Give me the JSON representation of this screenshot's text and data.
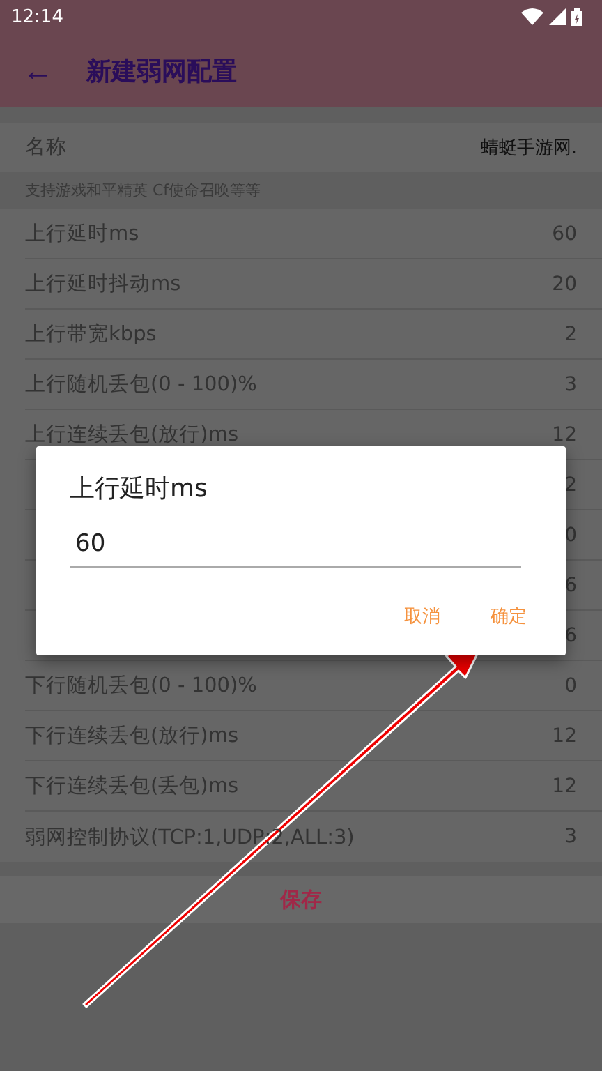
{
  "status_bar": {
    "time": "12:14"
  },
  "app_bar": {
    "back_icon": "←",
    "title": "新建弱网配置"
  },
  "name_row": {
    "label": "名称",
    "value": "蜻蜓手游网."
  },
  "hint": "支持游戏和平精英 Cf使命召唤等等",
  "rows": [
    {
      "label": "上行延时ms",
      "value": "60"
    },
    {
      "label": "上行延时抖动ms",
      "value": "20"
    },
    {
      "label": "上行带宽kbps",
      "value": "2"
    },
    {
      "label": "上行随机丢包(0 - 100)%",
      "value": "3"
    },
    {
      "label": "上行连续丢包(放行)ms",
      "value": "12"
    },
    {
      "value": "2"
    },
    {
      "value": "0"
    },
    {
      "value": "6"
    },
    {
      "value": "6"
    },
    {
      "label": "下行随机丢包(0 - 100)%",
      "value": "0"
    },
    {
      "label": "下行连续丢包(放行)ms",
      "value": "12"
    },
    {
      "label": "下行连续丢包(丢包)ms",
      "value": "12"
    },
    {
      "label": "弱网控制协议(TCP:1,UDP:2,ALL:3)",
      "value": "3"
    }
  ],
  "save_button": "保存",
  "dialog": {
    "title": "上行延时ms",
    "value": "60",
    "buttons": [
      "取消",
      "确定"
    ]
  }
}
